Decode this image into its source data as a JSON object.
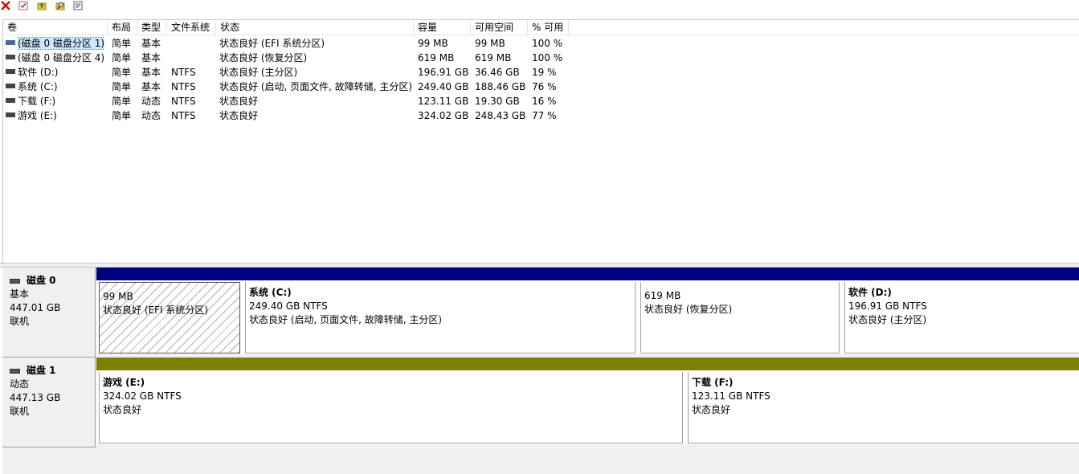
{
  "toolbar": {
    "icons": [
      "delete-icon",
      "check-icon",
      "up-folder-icon",
      "search-icon",
      "properties-icon"
    ]
  },
  "list": {
    "headers": {
      "volume": "卷",
      "layout": "布局",
      "type": "类型",
      "fs": "文件系统",
      "status": "状态",
      "capacity": "容量",
      "free": "可用空间",
      "pct": "% 可用"
    },
    "rows": [
      {
        "volume": "(磁盘 0 磁盘分区 1)",
        "layout": "简单",
        "type": "基本",
        "fs": "",
        "status": "状态良好 (EFI 系统分区)",
        "capacity": "99 MB",
        "free": "99 MB",
        "pct": "100 %"
      },
      {
        "volume": "(磁盘 0 磁盘分区 4)",
        "layout": "简单",
        "type": "基本",
        "fs": "",
        "status": "状态良好 (恢复分区)",
        "capacity": "619 MB",
        "free": "619 MB",
        "pct": "100 %"
      },
      {
        "volume": "软件 (D:)",
        "layout": "简单",
        "type": "基本",
        "fs": "NTFS",
        "status": "状态良好 (主分区)",
        "capacity": "196.91 GB",
        "free": "36.46 GB",
        "pct": "19 %"
      },
      {
        "volume": "系统 (C:)",
        "layout": "简单",
        "type": "基本",
        "fs": "NTFS",
        "status": "状态良好 (启动, 页面文件, 故障转储, 主分区)",
        "capacity": "249.40 GB",
        "free": "188.46 GB",
        "pct": "76 %"
      },
      {
        "volume": "下载 (F:)",
        "layout": "简单",
        "type": "动态",
        "fs": "NTFS",
        "status": "状态良好",
        "capacity": "123.11 GB",
        "free": "19.30 GB",
        "pct": "16 %"
      },
      {
        "volume": "游戏 (E:)",
        "layout": "简单",
        "type": "动态",
        "fs": "NTFS",
        "status": "状态良好",
        "capacity": "324.02 GB",
        "free": "248.43 GB",
        "pct": "77 %"
      }
    ]
  },
  "disks": [
    {
      "title": "磁盘 0",
      "kind": "基本",
      "size": "447.01 GB",
      "state": "联机",
      "bar_color": "#000080",
      "partitions": [
        {
          "name": "",
          "size": "99 MB",
          "status": "状态良好 (EFI 系统分区)",
          "hatched": true
        },
        {
          "name": "系统  (C:)",
          "size": "249.40 GB NTFS",
          "status": "状态良好 (启动, 页面文件, 故障转储, 主分区)",
          "hatched": false
        },
        {
          "name": "",
          "size": "619 MB",
          "status": "状态良好 (恢复分区)",
          "hatched": false
        },
        {
          "name": "软件  (D:)",
          "size": "196.91 GB NTFS",
          "status": "状态良好 (主分区)",
          "hatched": false
        }
      ]
    },
    {
      "title": "磁盘 1",
      "kind": "动态",
      "size": "447.13 GB",
      "state": "联机",
      "bar_color": "#808000",
      "partitions": [
        {
          "name": "游戏  (E:)",
          "size": "324.02 GB NTFS",
          "status": "状态良好",
          "hatched": false
        },
        {
          "name": "下载  (F:)",
          "size": "123.11 GB NTFS",
          "status": "状态良好",
          "hatched": false
        }
      ]
    }
  ]
}
